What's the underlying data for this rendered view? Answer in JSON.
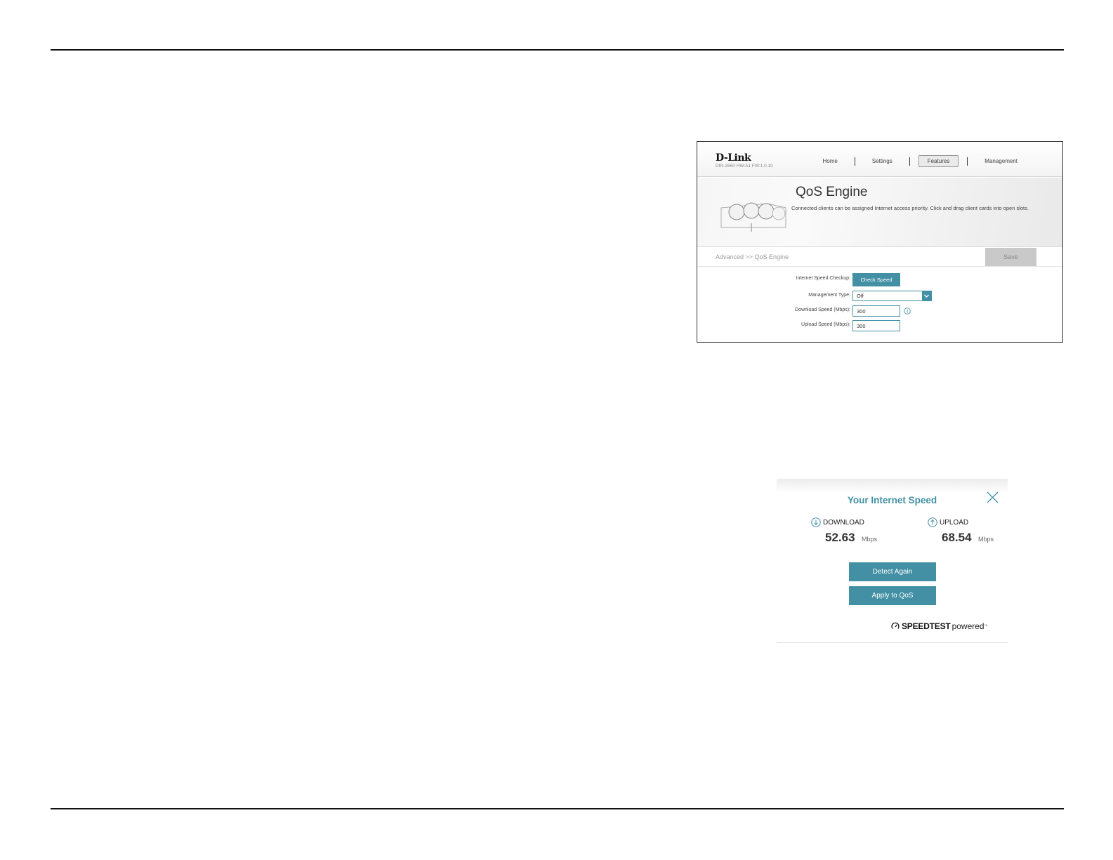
{
  "qos": {
    "brand": "D-Link",
    "brand_sub": "DIR-2660 HW:A1 FW:1.0.10",
    "nav": [
      "Home",
      "Settings",
      "Features",
      "Management"
    ],
    "title": "QoS Engine",
    "description": "Connected clients can be assigned Internet access priority. Click and drag client cards into open slots.",
    "breadcrumb": "Advanced >> QoS Engine",
    "save_label": "Save",
    "form": {
      "speed_check_label": "Internet Speed Checkup:",
      "check_speed_button": "Check Speed",
      "management_type_label": "Management Type:",
      "management_type_value": "Off",
      "download_label": "Download Speed (Mbps):",
      "download_value": "300",
      "upload_label": "Upload Speed (Mbps):",
      "upload_value": "300"
    }
  },
  "speedtest": {
    "title": "Your Internet Speed",
    "download_label": "DOWNLOAD",
    "download_value": "52.63",
    "download_unit": "Mbps",
    "upload_label": "UPLOAD",
    "upload_value": "68.54",
    "upload_unit": "Mbps",
    "detect_again": "Detect Again",
    "apply_qos": "Apply to QoS",
    "powered_bold": "SPEEDTEST",
    "powered_light": "powered",
    "trademark": "™"
  },
  "colors": {
    "accent": "#4390a4",
    "save_disabled": "#c9c9c9"
  }
}
